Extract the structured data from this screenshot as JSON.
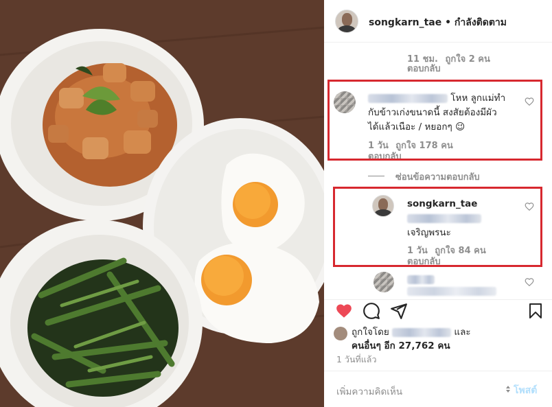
{
  "post": {
    "username": "songkarn_tae",
    "separator": "•",
    "follow_status": "กำลังติดตาม"
  },
  "comments": {
    "top_reply_meta": {
      "time": "11 ชม.",
      "likes": "ถูกใจ 2 คน",
      "reply": "ตอบกลับ"
    },
    "comment1": {
      "text_line1": "โหห ลูกแม่ทำ",
      "text_line2": "กับข้าวเก่งขนาดนี้ สงสัยต้องมีผัว",
      "text_line3": "ได้แล้วเนือะ / หยอกๆ 😉",
      "time": "1 วัน",
      "likes": "ถูกใจ 178 คน",
      "reply": "ตอบกลับ"
    },
    "hide_replies": "ซ่อนข้อความตอบกลับ",
    "reply1": {
      "username": "songkarn_tae",
      "text": "เจริญพรนะ",
      "time": "1 วัน",
      "likes": "ถูกใจ 84 คน",
      "reply": "ตอบกลับ"
    }
  },
  "likes_summary": {
    "prefix": "ถูกใจโดย",
    "and": "และ",
    "others": "คนอื่นๆ อีก 27,762 คน"
  },
  "time_ago": "1 วันที่แล้ว",
  "add_comment": {
    "placeholder": "เพิ่มความคิดเห็น",
    "post_label": "โพสต์"
  },
  "icons": [
    "heart-filled-icon",
    "comment-icon",
    "share-icon",
    "bookmark-icon",
    "heart-outline-icon"
  ],
  "colors": {
    "liked_heart": "#ed4956",
    "highlight_box": "#d7282f",
    "post_button": "#b2dffc"
  }
}
